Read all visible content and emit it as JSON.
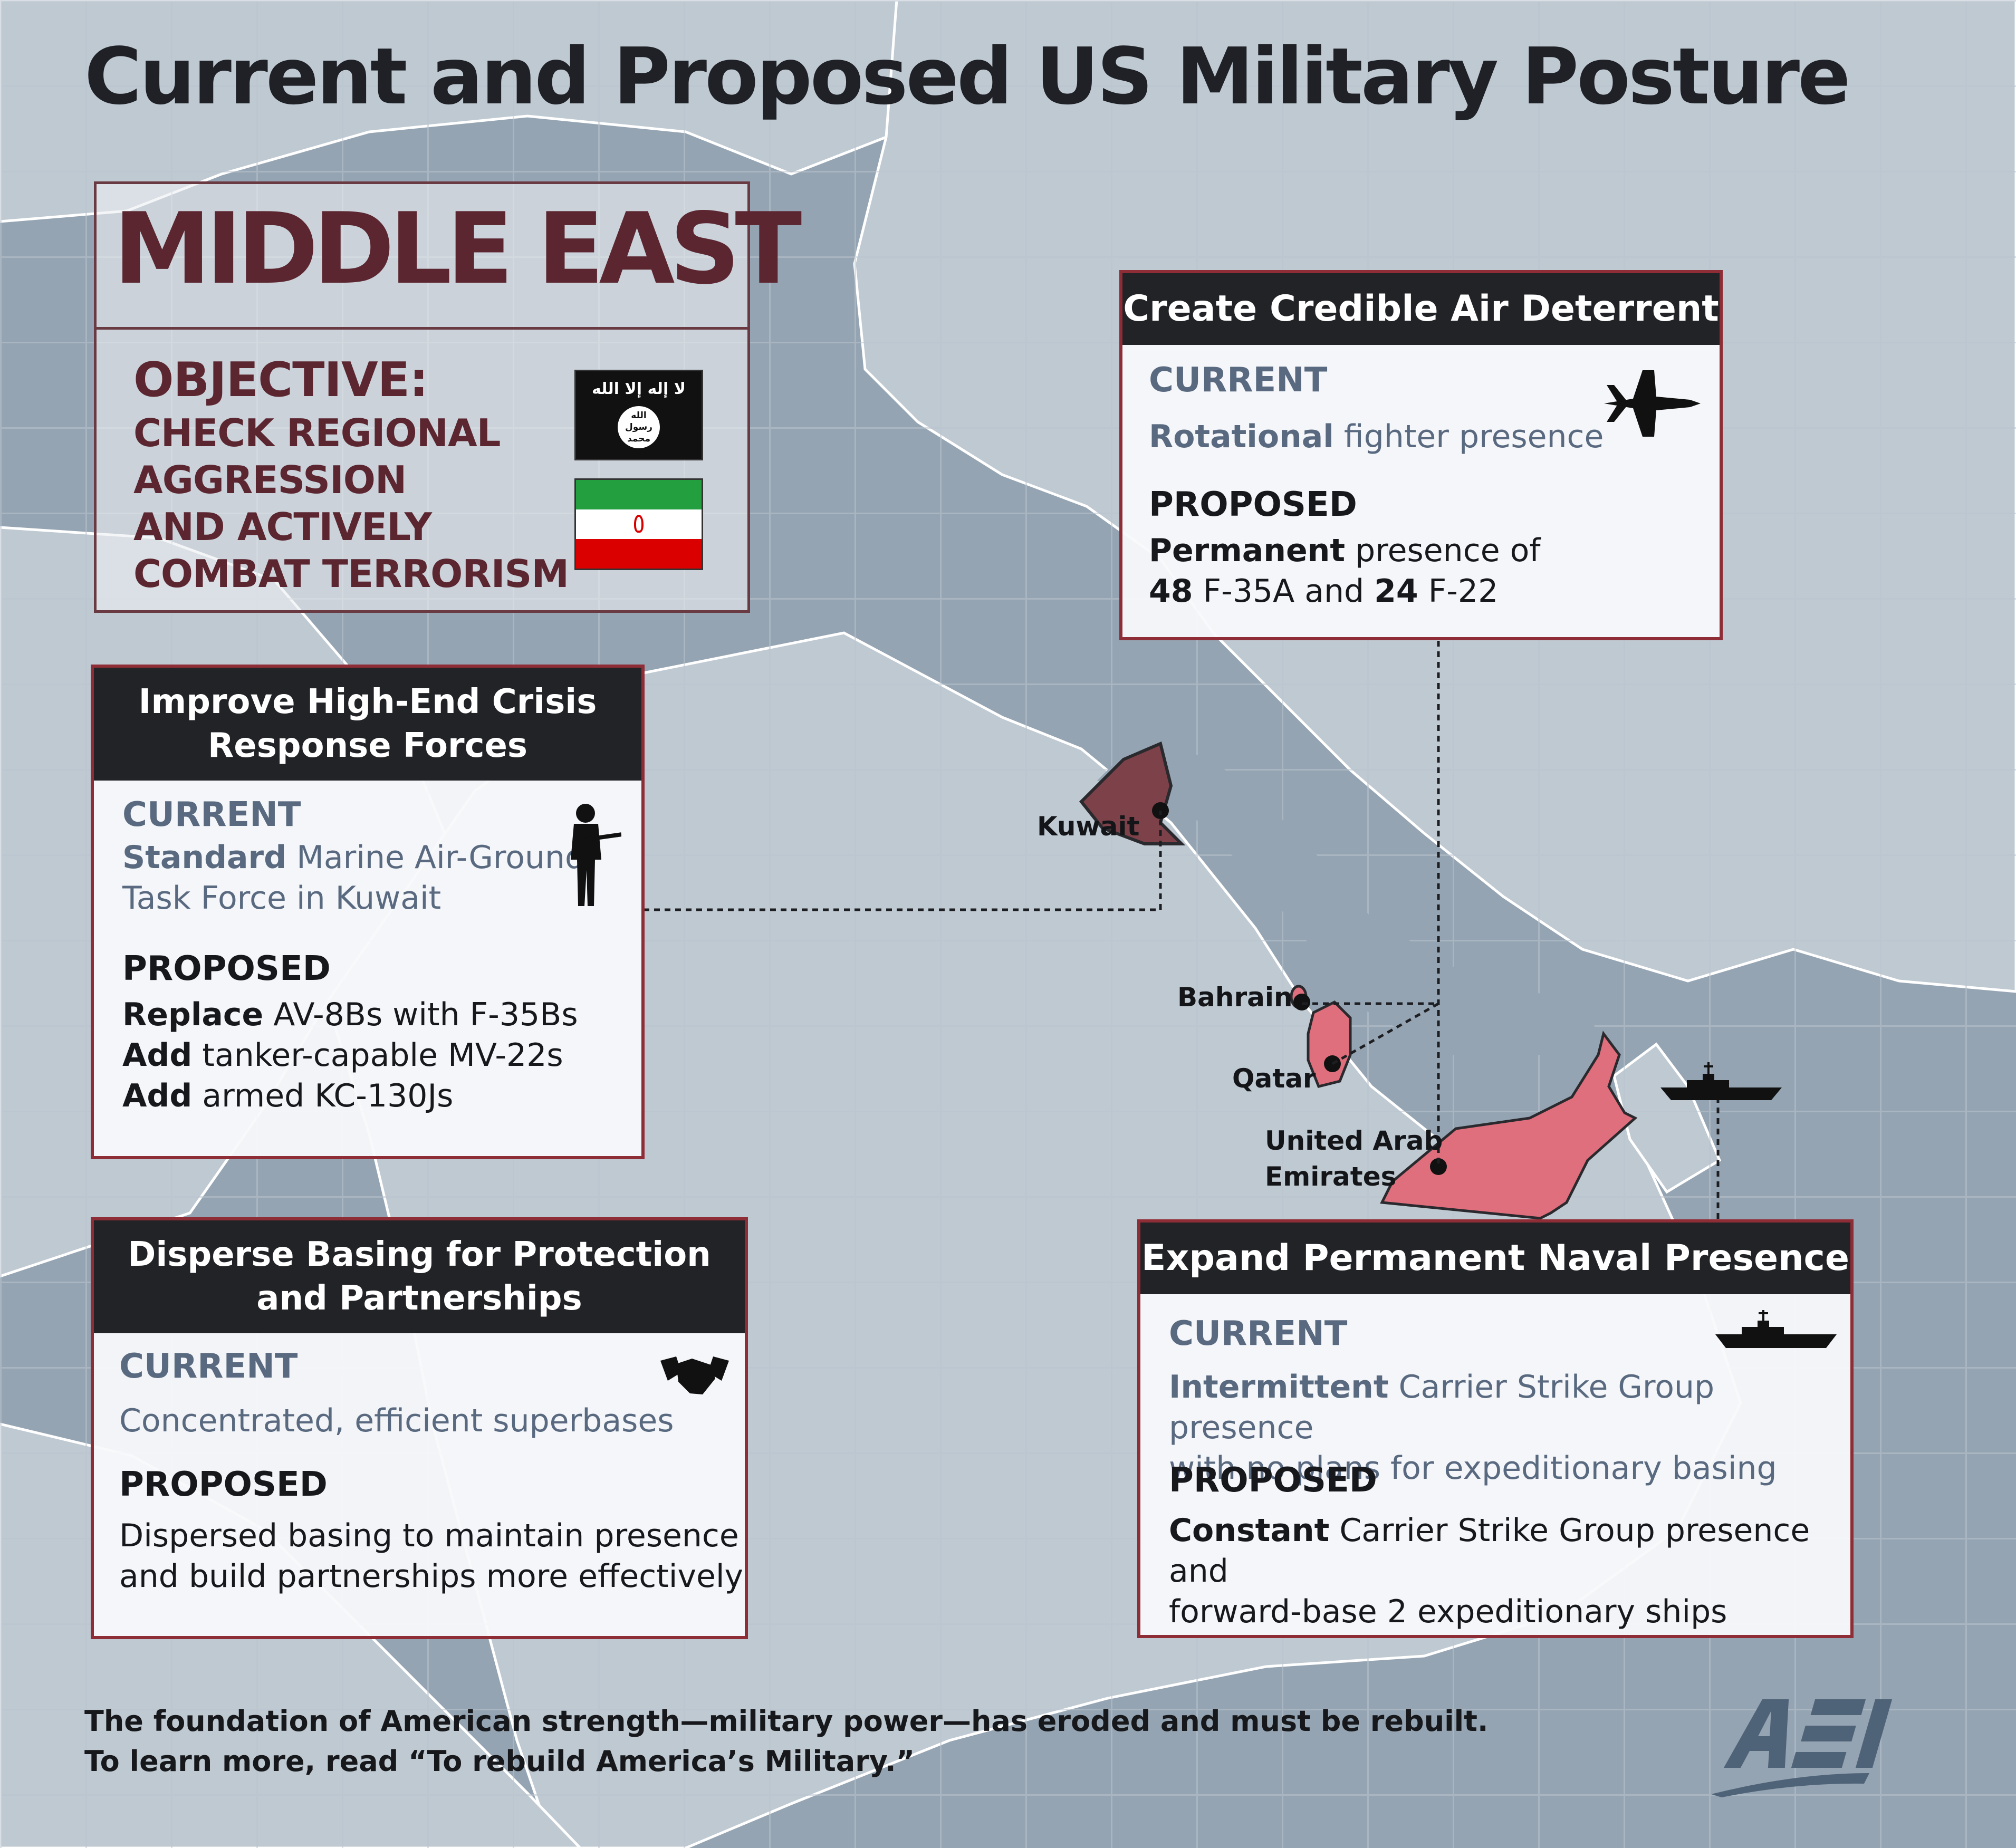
{
  "title": "Current and Proposed US Military Posture",
  "region": {
    "name": "MIDDLE EAST",
    "objective_label": "OBJECTIVE:",
    "objective_lines": [
      "CHECK REGIONAL",
      "AGGRESSION",
      "AND ACTIVELY",
      "COMBAT TERRORISM"
    ],
    "flags": [
      {
        "icon": "isis-flag-icon",
        "text_top": "لا إله إلا الله",
        "text_seal": "الله رسول محمد"
      },
      {
        "icon": "iran-flag-icon"
      }
    ]
  },
  "cards": {
    "air": {
      "title": "Create Credible Air Deterrent",
      "current_label": "CURRENT",
      "current_bold": "Rotational",
      "current_rest": " fighter presence",
      "proposed_label": "PROPOSED",
      "proposed_line1_bold": "Permanent",
      "proposed_line1_rest": " presence of",
      "proposed_line2_bold1": "48",
      "proposed_line2_mid": " F-35A and ",
      "proposed_line2_bold2": "24",
      "proposed_line2_rest": " F-22",
      "icon": "fighter-jet-icon"
    },
    "crisis": {
      "title_line1": "Improve High-End Crisis",
      "title_line2": "Response Forces",
      "current_label": "CURRENT",
      "current_bold": "Standard",
      "current_rest": " Marine  Air-Ground",
      "current_line2": "Task Force in Kuwait",
      "proposed_label": "PROPOSED",
      "p1_bold": "Replace",
      "p1_rest": " AV-8Bs with F-35Bs",
      "p2_bold": "Add",
      "p2_rest": " tanker-capable MV-22s",
      "p3_bold": "Add",
      "p3_rest": " armed KC-130Js",
      "icon": "soldier-icon"
    },
    "basing": {
      "title_line1": "Disperse Basing for Protection",
      "title_line2": "and Partnerships",
      "current_label": "CURRENT",
      "current_text": "Concentrated, efficient superbases",
      "proposed_label": "PROPOSED",
      "proposed_line1": "Dispersed basing to maintain presence",
      "proposed_line2": "and build partnerships more effectively",
      "icon": "handshake-icon"
    },
    "naval": {
      "title": "Expand Permanent Naval Presence",
      "current_label": "CURRENT",
      "current_bold": "Intermittent",
      "current_rest": " Carrier Strike Group presence",
      "current_line2": "with no plans for  expeditionary basing",
      "proposed_label": "PROPOSED",
      "p1_bold": "Constant",
      "p1_rest": " Carrier Strike Group presence and",
      "p2": "forward-base 2 expeditionary ships",
      "icon": "warship-icon"
    }
  },
  "map": {
    "places": [
      "Kuwait",
      "Bahrain",
      "Qatar",
      "United Arab",
      "Emirates"
    ],
    "colors": {
      "sea": "#95a4b2",
      "land": "#bfc9d2",
      "kuwait": "#7d4249",
      "gulf_states": "#df6f7d",
      "border": "#8f2d36"
    },
    "map_icon": "warship-icon"
  },
  "footer": {
    "line1": "The foundation of American strength—military power—has eroded and must be rebuilt.",
    "line2": "To learn more, read “To rebuild America’s Military.”"
  },
  "logo": {
    "text": "AEI",
    "color": "#4f6378"
  }
}
